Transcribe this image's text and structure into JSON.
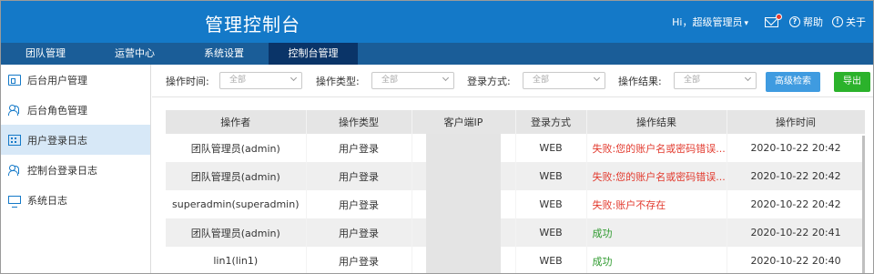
{
  "header": {
    "title": "管理控制台",
    "user": "Hi，超级管理员",
    "help": "帮助",
    "about": "关于"
  },
  "nav": {
    "items": [
      "团队管理",
      "运营中心",
      "系统设置",
      "控制台管理"
    ],
    "active_index": 3
  },
  "sidebar": {
    "items": [
      {
        "label": "后台用户管理",
        "icon": "id-card-icon"
      },
      {
        "label": "后台角色管理",
        "icon": "users-icon"
      },
      {
        "label": "用户登录日志",
        "icon": "building-icon"
      },
      {
        "label": "控制台登录日志",
        "icon": "users-icon"
      },
      {
        "label": "系统日志",
        "icon": "monitor-icon"
      }
    ],
    "active_index": 2
  },
  "filters": {
    "operation_time": {
      "label": "操作时间:",
      "value": "全部"
    },
    "operation_type": {
      "label": "操作类型:",
      "value": "全部"
    },
    "login_method": {
      "label": "登录方式:",
      "value": "全部"
    },
    "operation_result": {
      "label": "操作结果:",
      "value": "全部"
    },
    "advanced_search": "高级检索",
    "export": "导出"
  },
  "table": {
    "columns": [
      "操作者",
      "操作类型",
      "客户端IP",
      "登录方式",
      "操作结果",
      "操作时间"
    ],
    "rows": [
      {
        "operator": "团队管理员(admin)",
        "type": "用户登录",
        "ip": "",
        "method": "WEB",
        "result": "失败:您的账户名或密码错误...",
        "status": "fail",
        "time": "2020-10-22 20:42"
      },
      {
        "operator": "团队管理员(admin)",
        "type": "用户登录",
        "ip": "",
        "method": "WEB",
        "result": "失败:您的账户名或密码错误...",
        "status": "fail",
        "time": "2020-10-22 20:42"
      },
      {
        "operator": "superadmin(superadmin)",
        "type": "用户登录",
        "ip": "",
        "method": "WEB",
        "result": "失败:账户不存在",
        "status": "fail",
        "time": "2020-10-22 20:42"
      },
      {
        "operator": "团队管理员(admin)",
        "type": "用户登录",
        "ip": "",
        "method": "WEB",
        "result": "成功",
        "status": "ok",
        "time": "2020-10-22 20:41"
      },
      {
        "operator": "lin1(lin1)",
        "type": "用户登录",
        "ip": "",
        "method": "WEB",
        "result": "成功",
        "status": "ok",
        "time": "2020-10-22 20:40"
      }
    ]
  },
  "colors": {
    "header_bg": "#1479c8",
    "nav_bg": "#1a5d98",
    "nav_active": "#0a3468",
    "fail": "#e23a2e",
    "success": "#2e9a2e",
    "advanced_btn": "#3f9be0",
    "export_btn": "#2bb22b"
  }
}
